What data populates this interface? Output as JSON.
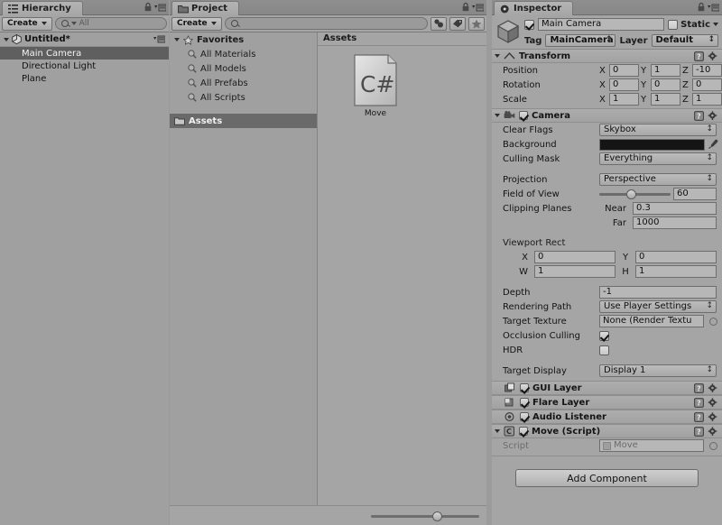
{
  "hierarchy": {
    "tab_label": "Hierarchy",
    "create_label": "Create",
    "search_placeholder": "All",
    "search_value": "All",
    "root": "Untitled*",
    "items": [
      {
        "label": "Main Camera",
        "selected": true
      },
      {
        "label": "Directional Light",
        "selected": false
      },
      {
        "label": "Plane",
        "selected": false
      }
    ]
  },
  "project": {
    "tab_label": "Project",
    "create_label": "Create",
    "search_placeholder": "",
    "search_value": "",
    "favorites_label": "Favorites",
    "favorites": [
      "All Materials",
      "All Models",
      "All Prefabs",
      "All Scripts"
    ],
    "folder_label": "Assets",
    "grid_header": "Assets",
    "assets": [
      {
        "name": "Move",
        "type": "C#"
      }
    ],
    "zoom_value": 57
  },
  "inspector": {
    "tab_label": "Inspector",
    "object_enabled": true,
    "object_name": "Main Camera",
    "static_label": "Static",
    "static_checked": false,
    "tag_label": "Tag",
    "tag_value": "MainCamera",
    "layer_label": "Layer",
    "layer_value": "Default",
    "transform": {
      "title": "Transform",
      "position_label": "Position",
      "rotation_label": "Rotation",
      "scale_label": "Scale",
      "position": {
        "x": "0",
        "y": "1",
        "z": "-10"
      },
      "rotation": {
        "x": "0",
        "y": "0",
        "z": "0"
      },
      "scale": {
        "x": "1",
        "y": "1",
        "z": "1"
      },
      "axis_x": "X",
      "axis_y": "Y",
      "axis_z": "Z"
    },
    "camera": {
      "title": "Camera",
      "enabled": true,
      "clear_flags_label": "Clear Flags",
      "clear_flags_value": "Skybox",
      "background_label": "Background",
      "background_color": "#131313",
      "culling_mask_label": "Culling Mask",
      "culling_mask_value": "Everything",
      "projection_label": "Projection",
      "projection_value": "Perspective",
      "fov_label": "Field of View",
      "fov_value": "60",
      "clipping_label": "Clipping Planes",
      "near_label": "Near",
      "near_value": "0.3",
      "far_label": "Far",
      "far_value": "1000",
      "viewport_label": "Viewport Rect",
      "viewport_x_label": "X",
      "viewport_x": "0",
      "viewport_y_label": "Y",
      "viewport_y": "0",
      "viewport_w_label": "W",
      "viewport_w": "1",
      "viewport_h_label": "H",
      "viewport_h": "1",
      "depth_label": "Depth",
      "depth_value": "-1",
      "rendering_path_label": "Rendering Path",
      "rendering_path_value": "Use Player Settings",
      "target_texture_label": "Target Texture",
      "target_texture_value": "None (Render Textu",
      "occlusion_label": "Occlusion Culling",
      "occlusion_checked": true,
      "hdr_label": "HDR",
      "hdr_checked": false,
      "target_display_label": "Target Display",
      "target_display_value": "Display 1"
    },
    "components": [
      {
        "title": "GUI Layer",
        "enabled": true,
        "icon": "gui-layer-icon"
      },
      {
        "title": "Flare Layer",
        "enabled": true,
        "icon": "flare-layer-icon"
      },
      {
        "title": "Audio Listener",
        "enabled": true,
        "icon": "audio-listener-icon"
      }
    ],
    "script_component": {
      "title": "Move (Script)",
      "enabled": true,
      "script_label": "Script",
      "script_value": "Move"
    },
    "add_component_label": "Add Component"
  }
}
